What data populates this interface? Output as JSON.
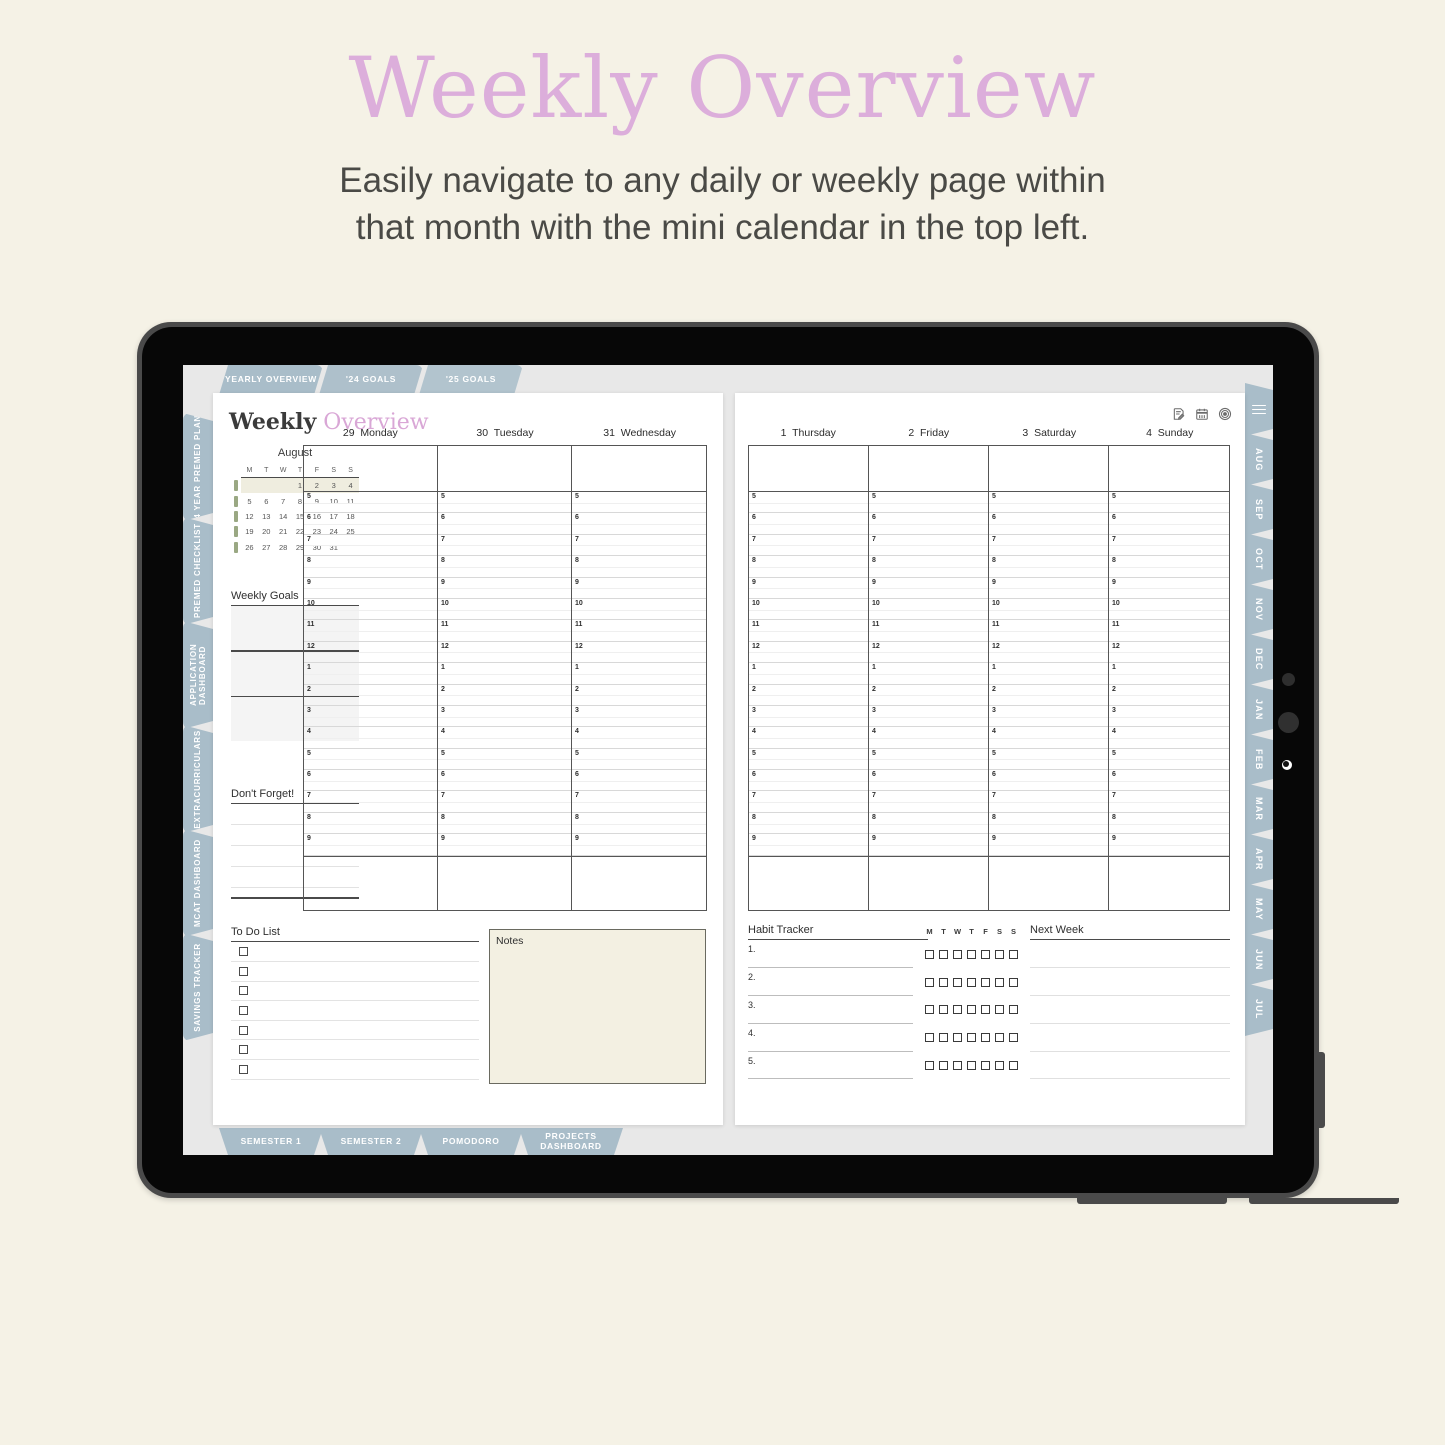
{
  "promo": {
    "title": "Weekly Overview",
    "title_color": "#dcaedb",
    "subtitle_line1": "Easily navigate to any daily or weekly page within",
    "subtitle_line2": "that month with the mini calendar in the top left."
  },
  "planner": {
    "tab_color": "#a9bdc9",
    "top_tabs": [
      "YEARLY OVERVIEW",
      "'24 GOALS",
      "'25 GOALS"
    ],
    "left_tabs": [
      "4 YEAR PREMED PLAN",
      "PREMED CHECKLIST",
      "APPLICATION DASHBOARD",
      "EXTRACURRICULARS",
      "MCAT DASHBOARD",
      "SAVINGS TRACKER"
    ],
    "right_tabs": [
      "AUG",
      "SEP",
      "OCT",
      "NOV",
      "DEC",
      "JAN",
      "FEB",
      "MAR",
      "APR",
      "MAY",
      "JUN",
      "JUL"
    ],
    "right_menu_icon": "hamburger-menu-icon",
    "bottom_tabs": [
      "SEMESTER 1",
      "SEMESTER 2",
      "POMODORO",
      "PROJECTS DASHBOARD"
    ]
  },
  "page": {
    "title_word1": "Weekly",
    "title_word2": "Overview",
    "header_icons": [
      "notes-icon",
      "calendar-icon",
      "target-icon"
    ]
  },
  "mini_calendar": {
    "month": "August",
    "weekday_headers": [
      "M",
      "T",
      "W",
      "T",
      "F",
      "S",
      "S"
    ],
    "weeks": [
      [
        "",
        "",
        "",
        "1",
        "2",
        "3",
        "4"
      ],
      [
        "5",
        "6",
        "7",
        "8",
        "9",
        "10",
        "11"
      ],
      [
        "12",
        "13",
        "14",
        "15",
        "16",
        "17",
        "18"
      ],
      [
        "19",
        "20",
        "21",
        "22",
        "23",
        "24",
        "25"
      ],
      [
        "26",
        "27",
        "28",
        "29",
        "30",
        "31",
        ""
      ]
    ],
    "highlighted_week_index": 0,
    "marker_color": "#9aa883",
    "highlight_color": "#efeddf"
  },
  "weekly_goals": {
    "heading": "Weekly Goals",
    "box_count": 3
  },
  "dont_forget": {
    "heading": "Don't Forget!",
    "line_count": 4
  },
  "to_do_list": {
    "heading": "To Do List",
    "row_count": 7
  },
  "notes": {
    "heading": "Notes",
    "background": "#f3f0e2"
  },
  "schedule": {
    "left_days": [
      {
        "num": "29",
        "name": "Monday"
      },
      {
        "num": "30",
        "name": "Tuesday"
      },
      {
        "num": "31",
        "name": "Wednesday"
      }
    ],
    "right_days": [
      {
        "num": "1",
        "name": "Thursday"
      },
      {
        "num": "2",
        "name": "Friday"
      },
      {
        "num": "3",
        "name": "Saturday"
      },
      {
        "num": "4",
        "name": "Sunday"
      }
    ],
    "hours": [
      "5",
      "6",
      "7",
      "8",
      "9",
      "10",
      "11",
      "12",
      "1",
      "2",
      "3",
      "4",
      "5",
      "6",
      "7",
      "8",
      "9"
    ]
  },
  "habit_tracker": {
    "heading": "Habit Tracker",
    "day_headers": [
      "M",
      "T",
      "W",
      "T",
      "F",
      "S",
      "S"
    ],
    "rows": [
      "1.",
      "2.",
      "3.",
      "4.",
      "5."
    ]
  },
  "next_week": {
    "heading": "Next Week",
    "line_count": 5
  }
}
